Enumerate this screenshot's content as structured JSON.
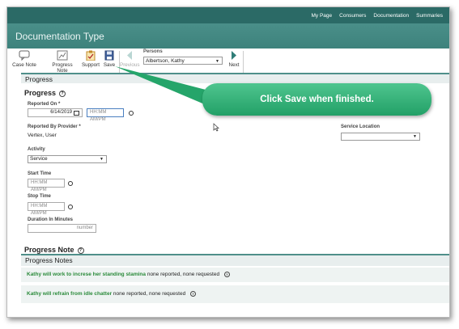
{
  "topnav": [
    "My Page",
    "Consumers",
    "Documentation",
    "Summaries"
  ],
  "page_title": "Documentation Type",
  "toolbar": {
    "case_note": "Case Note",
    "progress_note": "Progress Note",
    "support": "Support",
    "save": "Save",
    "previous": "Previous",
    "next": "Next",
    "persons_label": "Persons",
    "persons_value": "Albertson, Kathy"
  },
  "progress_band": "Progress",
  "progress_heading": "Progress",
  "reported_on_label": "Reported On *",
  "reported_on_date": "6/14/2019",
  "reported_on_time_placeholder": "HH:MM AM/PM",
  "reported_by_label": "Reported By Provider *",
  "reported_by_value": "Vertex, User",
  "service_location_label": "Service Location",
  "activity_label": "Activity",
  "activity_value": "Service",
  "start_time_label": "Start Time",
  "start_time_placeholder": "HH:MM AM/PM",
  "stop_time_label": "Stop Time",
  "stop_time_placeholder": "HH:MM AM/PM",
  "duration_label": "Duration In Minutes",
  "duration_placeholder": "number",
  "progress_note_heading": "Progress Note",
  "progress_notes_band": "Progress Notes",
  "notes": [
    {
      "goal": "Kathy will work to increse her standing stamina",
      "status": "none reported, none requested"
    },
    {
      "goal": "Kathy will refrain from idle chatter",
      "status": "none reported, none requested"
    }
  ],
  "callout_text": "Click Save when finished.",
  "colors": {
    "header": "#2b6a66",
    "title_bar": "#4a8f89",
    "callout": "#27a86d",
    "goal_text": "#2a8a3a"
  }
}
